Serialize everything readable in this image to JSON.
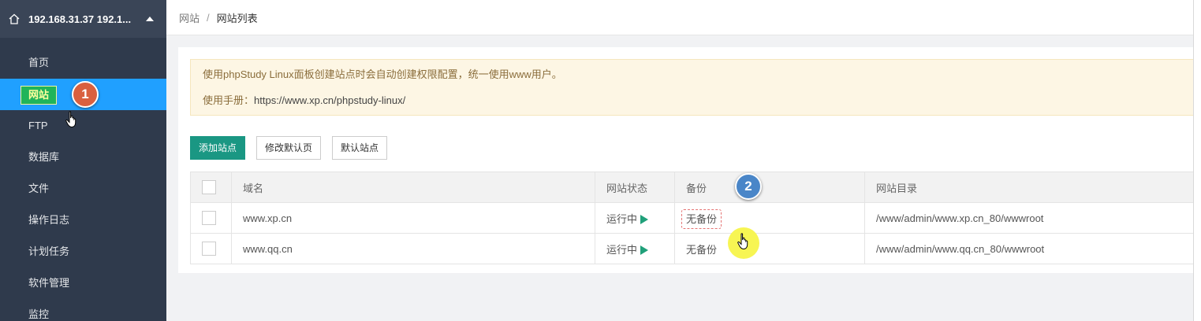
{
  "sidebar": {
    "server_label": "192.168.31.37 192.1...",
    "items": [
      {
        "label": "首页"
      },
      {
        "label": "网站",
        "active": true
      },
      {
        "label": "FTP"
      },
      {
        "label": "数据库"
      },
      {
        "label": "文件"
      },
      {
        "label": "操作日志"
      },
      {
        "label": "计划任务"
      },
      {
        "label": "软件管理"
      },
      {
        "label": "监控"
      }
    ]
  },
  "breadcrumb": {
    "root": "网站",
    "separator": "/",
    "current": "网站列表"
  },
  "notice": {
    "line1": "使用phpStudy Linux面板创建站点时会自动创建权限配置，统一使用www用户。",
    "manual_label": "使用手册：",
    "manual_url": "https://www.xp.cn/phpstudy-linux/"
  },
  "buttons": {
    "add_site": "添加站点",
    "edit_default_page": "修改默认页",
    "default_site": "默认站点"
  },
  "table": {
    "columns": {
      "domain": "域名",
      "status": "网站状态",
      "backup": "备份",
      "root": "网站目录"
    },
    "rows": [
      {
        "domain": "www.xp.cn",
        "status": "运行中",
        "backup": "无备份",
        "root": "/www/admin/www.xp.cn_80/wwwroot"
      },
      {
        "domain": "www.qq.cn",
        "status": "运行中",
        "backup": "无备份",
        "root": "/www/admin/www.qq.cn_80/wwwroot"
      }
    ]
  },
  "annotations": {
    "step1": "1",
    "step2": "2"
  },
  "colors": {
    "sidebar_bg": "#2f3a4c",
    "active_bg": "#20a0ff",
    "primary_button": "#1a9783",
    "notice_bg": "#fdf6e4",
    "run_arrow": "#20a07a"
  }
}
